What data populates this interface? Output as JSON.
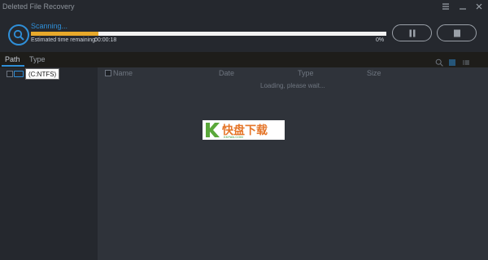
{
  "window": {
    "title": "Deleted File Recovery",
    "controls": [
      "menu-icon",
      "minimize-icon",
      "close-icon"
    ]
  },
  "scan": {
    "status": "Scanning...",
    "eta_label": "Estimated time remaining:",
    "eta_value": "00:00:18",
    "percent_text": "0%",
    "progress_fraction": 0.19,
    "pause_icon": "pause-icon",
    "stop_icon": "stop-icon"
  },
  "tabs": [
    {
      "label": "Path",
      "active": true
    },
    {
      "label": "Type",
      "active": false
    }
  ],
  "view_icons": [
    "search-icon",
    "list-view-icon",
    "detail-view-icon"
  ],
  "tree": {
    "drive_label": "(C:NTFS)",
    "drive_icon": "drive-icon"
  },
  "file_list": {
    "columns": [
      "Name",
      "Date",
      "Type",
      "Size"
    ],
    "loading_text": "Loading, please wait..."
  },
  "watermark": {
    "text": "快盘下载",
    "sub": "KKPAN.COM"
  },
  "colors": {
    "accent": "#2f8fd8",
    "progress": "#e8a92b",
    "background": "#2b2f36"
  }
}
